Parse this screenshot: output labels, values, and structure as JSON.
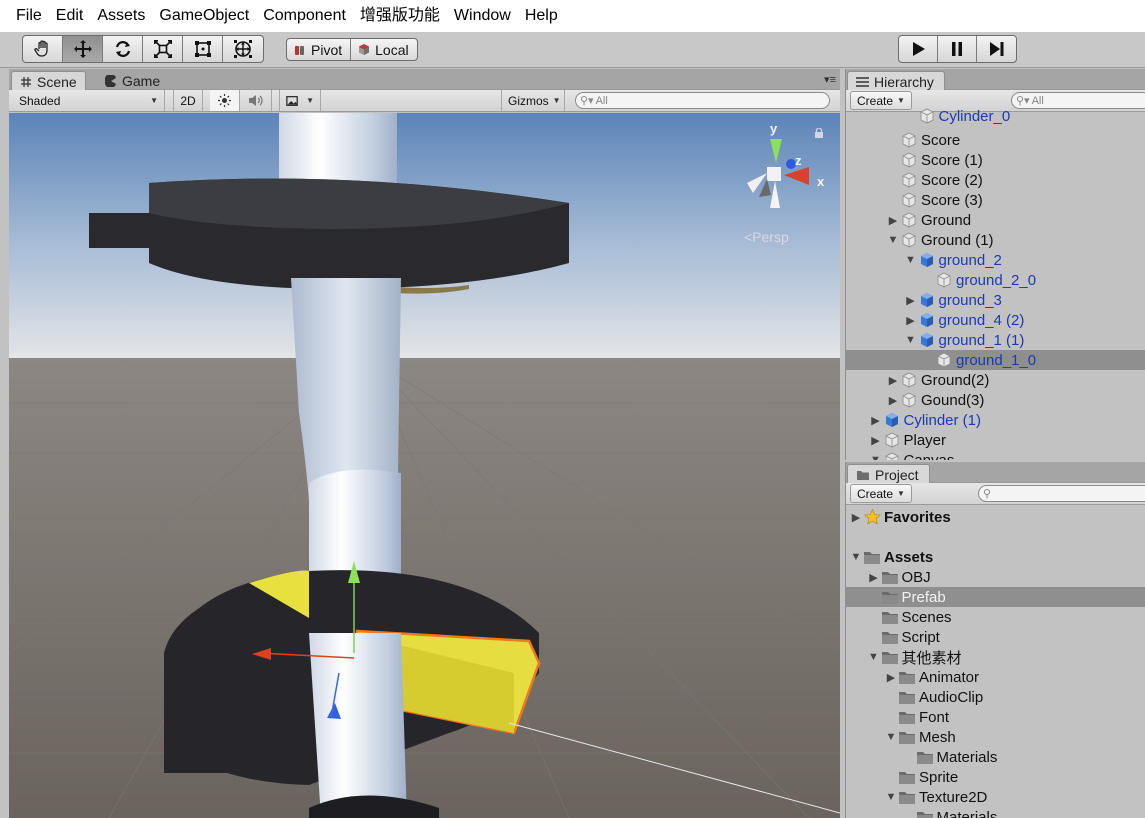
{
  "menu": [
    "File",
    "Edit",
    "Assets",
    "GameObject",
    "Component",
    "增强版功能",
    "Window",
    "Help"
  ],
  "toolbar": {
    "tools": [
      {
        "name": "hand-tool-icon"
      },
      {
        "name": "move-tool-icon"
      },
      {
        "name": "rotate-tool-icon"
      },
      {
        "name": "scale-tool-icon"
      },
      {
        "name": "rect-tool-icon"
      },
      {
        "name": "transform-tool-icon"
      }
    ],
    "active_tool": "move",
    "pivot_label": "Pivot",
    "local_label": "Local"
  },
  "scene": {
    "tabs": [
      {
        "label": "Scene"
      },
      {
        "label": "Game"
      }
    ],
    "shading_mode": "Shaded",
    "mode_2d": "2D",
    "gizmos_label": "Gizmos",
    "search_placeholder": "All",
    "persp_label": "<Persp",
    "axis_labels": {
      "x": "x",
      "y": "y",
      "z": "z"
    }
  },
  "hierarchy": {
    "tab_label": "Hierarchy",
    "create_label": "Create",
    "search_placeholder": "All",
    "items": [
      {
        "label": "Cylinder_0",
        "depth": 3,
        "arrow": "",
        "icon": "gameobject",
        "blue": true,
        "partial": true
      },
      {
        "label": "Score",
        "depth": 2,
        "arrow": "",
        "icon": "gameobject",
        "blue": false
      },
      {
        "label": "Score (1)",
        "depth": 2,
        "arrow": "",
        "icon": "gameobject",
        "blue": false
      },
      {
        "label": "Score (2)",
        "depth": 2,
        "arrow": "",
        "icon": "gameobject",
        "blue": false
      },
      {
        "label": "Score (3)",
        "depth": 2,
        "arrow": "",
        "icon": "gameobject",
        "blue": false
      },
      {
        "label": "Ground",
        "depth": 2,
        "arrow": "▶",
        "icon": "gameobject",
        "blue": false
      },
      {
        "label": "Ground (1)",
        "depth": 2,
        "arrow": "▼",
        "icon": "gameobject",
        "blue": false
      },
      {
        "label": "ground_2",
        "depth": 3,
        "arrow": "▼",
        "icon": "prefab",
        "blue": true
      },
      {
        "label": "ground_2_0",
        "depth": 4,
        "arrow": "",
        "icon": "gameobject",
        "blue": true
      },
      {
        "label": "ground_3",
        "depth": 3,
        "arrow": "▶",
        "icon": "prefab",
        "blue": true
      },
      {
        "label": "ground_4 (2)",
        "depth": 3,
        "arrow": "▶",
        "icon": "prefab",
        "blue": true
      },
      {
        "label": "ground_1 (1)",
        "depth": 3,
        "arrow": "▼",
        "icon": "prefab",
        "blue": true
      },
      {
        "label": "ground_1_0",
        "depth": 4,
        "arrow": "",
        "icon": "gameobject",
        "blue": true,
        "selected": true
      },
      {
        "label": "Ground(2)",
        "depth": 2,
        "arrow": "▶",
        "icon": "gameobject",
        "blue": false
      },
      {
        "label": "Gound(3)",
        "depth": 2,
        "arrow": "▶",
        "icon": "gameobject",
        "blue": false
      },
      {
        "label": "Cylinder (1)",
        "depth": 1,
        "arrow": "▶",
        "icon": "prefab",
        "blue": true
      },
      {
        "label": "Player",
        "depth": 1,
        "arrow": "▶",
        "icon": "gameobject",
        "blue": false
      },
      {
        "label": "Canvas",
        "depth": 1,
        "arrow": "▼",
        "icon": "gameobject",
        "blue": false
      }
    ]
  },
  "project": {
    "tab_label": "Project",
    "create_label": "Create",
    "items": [
      {
        "label": "Favorites",
        "depth": 0,
        "arrow": "▶",
        "icon": "star",
        "bold": true
      },
      {
        "label": "",
        "depth": 0,
        "arrow": "",
        "icon": "none"
      },
      {
        "label": "Assets",
        "depth": 0,
        "arrow": "▼",
        "icon": "folder",
        "bold": true
      },
      {
        "label": "OBJ",
        "depth": 1,
        "arrow": "▶",
        "icon": "folder"
      },
      {
        "label": "Prefab",
        "depth": 1,
        "arrow": "",
        "icon": "folder",
        "selected": true
      },
      {
        "label": "Scenes",
        "depth": 1,
        "arrow": "",
        "icon": "folder"
      },
      {
        "label": "Script",
        "depth": 1,
        "arrow": "",
        "icon": "folder"
      },
      {
        "label": "其他素材",
        "depth": 1,
        "arrow": "▼",
        "icon": "folder"
      },
      {
        "label": "Animator",
        "depth": 2,
        "arrow": "▶",
        "icon": "folder"
      },
      {
        "label": "AudioClip",
        "depth": 2,
        "arrow": "",
        "icon": "folder"
      },
      {
        "label": "Font",
        "depth": 2,
        "arrow": "",
        "icon": "folder"
      },
      {
        "label": "Mesh",
        "depth": 2,
        "arrow": "▼",
        "icon": "folder"
      },
      {
        "label": "Materials",
        "depth": 3,
        "arrow": "",
        "icon": "folder"
      },
      {
        "label": "Sprite",
        "depth": 2,
        "arrow": "",
        "icon": "folder"
      },
      {
        "label": "Texture2D",
        "depth": 2,
        "arrow": "▼",
        "icon": "folder"
      },
      {
        "label": "Materials",
        "depth": 3,
        "arrow": "",
        "icon": "folder"
      }
    ]
  },
  "colors": {
    "selected_row": "#8f8f8f",
    "prefab_text": "#1a3bb0",
    "selection_outline": "#f07820",
    "ground_yellow": "#e6e040"
  }
}
